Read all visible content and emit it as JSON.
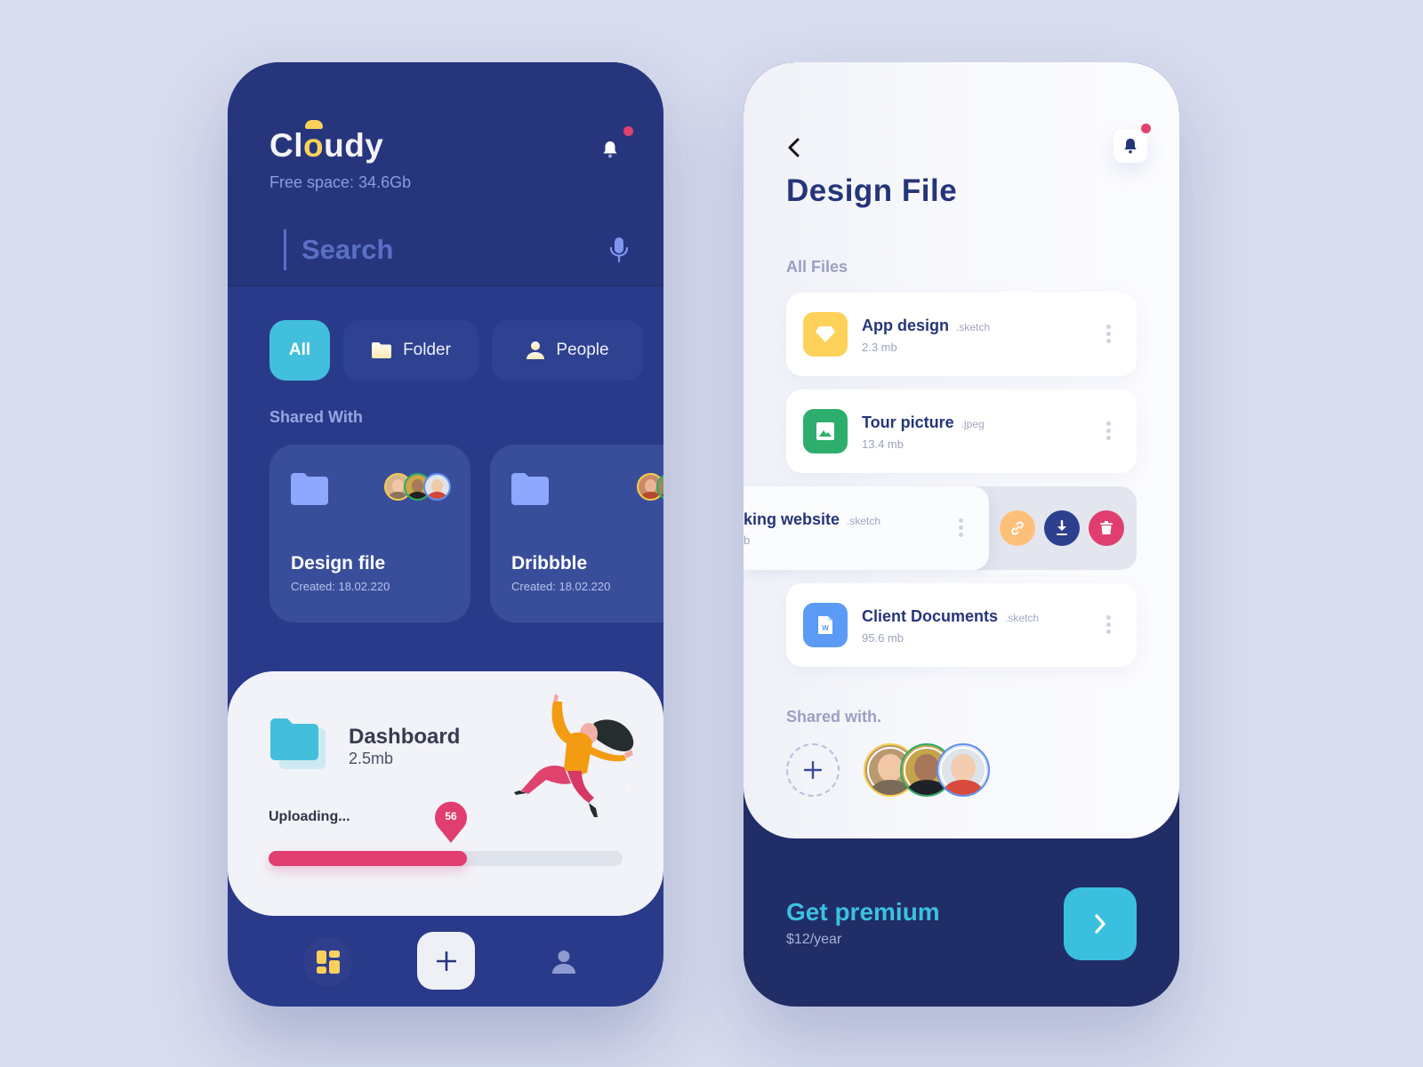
{
  "left_screen": {
    "logo": {
      "prefix": "Cl",
      "highlight": "o",
      "suffix": "udy"
    },
    "free_space": "Free space: 34.6Gb",
    "search": {
      "placeholder": "Search",
      "value": ""
    },
    "tabs": [
      {
        "label": "All",
        "icon": "none",
        "active": true
      },
      {
        "label": "Folder",
        "icon": "folder-icon",
        "active": false
      },
      {
        "label": "People",
        "icon": "person-icon",
        "active": false
      }
    ],
    "shared_with_title": "Shared With",
    "shared_cards": [
      {
        "name": "Design file",
        "created": "Created: 18.02.220",
        "avatars": [
          "yellow",
          "green",
          "blue"
        ]
      },
      {
        "name": "Dribbble",
        "created": "Created: 18.02.220",
        "avatars": [
          "yellow",
          "green",
          "blue"
        ]
      }
    ],
    "upload": {
      "title": "Dashboard",
      "size": "2.5mb",
      "status": "Uploading...",
      "progress_percent": 56,
      "progress_label": "56"
    },
    "bottom_nav": [
      {
        "name": "dashboard",
        "icon": "dashboard-icon"
      },
      {
        "name": "add",
        "icon": "plus-icon"
      },
      {
        "name": "profile",
        "icon": "person-icon"
      }
    ],
    "colors": {
      "accent": "#41bfdc",
      "logo_yellow": "#fcd15b",
      "progress": "#e03e70",
      "background": "#2a3a8a"
    }
  },
  "right_screen": {
    "title": "Design File",
    "all_files_label": "All Files",
    "files": [
      {
        "name": "App design",
        "ext": ".sketch",
        "size": "2.3 mb",
        "icon": "sketch-icon",
        "color": "#fdd15a"
      },
      {
        "name": "Tour picture",
        "ext": ".jpeg",
        "size": "13.4 mb",
        "icon": "image-icon",
        "color": "#2eae6c"
      },
      {
        "name": "king website",
        "ext": ".sketch",
        "size": "b",
        "icon": "sketch-icon",
        "color": "#fdd15a",
        "swiped": true
      },
      {
        "name": "Client Documents",
        "ext": ".sketch",
        "size": "95.6 mb",
        "icon": "word-doc-icon",
        "color": "#5b9af5"
      }
    ],
    "swipe_actions": [
      {
        "name": "link",
        "icon": "link-icon",
        "color": "#fec079"
      },
      {
        "name": "download",
        "icon": "download-icon",
        "color": "#2d3f8f"
      },
      {
        "name": "delete",
        "icon": "trash-icon",
        "color": "#e03e70"
      }
    ],
    "shared_with_label": "Shared with.",
    "shared_avatars": [
      "yellow",
      "green",
      "blue"
    ],
    "premium": {
      "title": "Get premium",
      "price": "$12/year"
    },
    "colors": {
      "title": "#25357a",
      "premium": "#3cc0e0",
      "footer": "#212d66"
    }
  }
}
